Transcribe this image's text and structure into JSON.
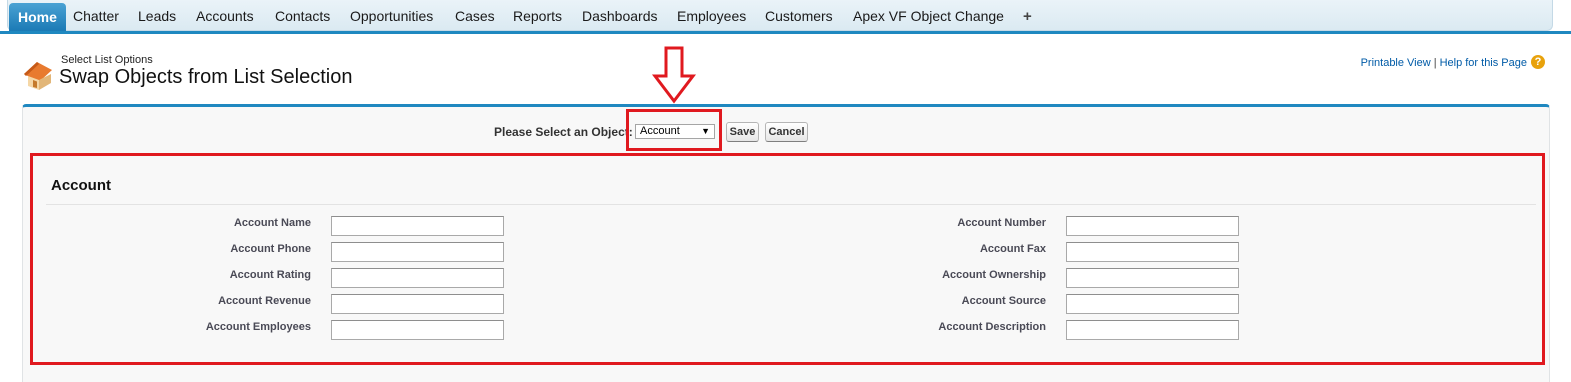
{
  "tabs": [
    {
      "label": "Home",
      "active": true
    },
    {
      "label": "Chatter"
    },
    {
      "label": "Leads"
    },
    {
      "label": "Accounts"
    },
    {
      "label": "Contacts"
    },
    {
      "label": "Opportunities"
    },
    {
      "label": "Cases"
    },
    {
      "label": "Reports"
    },
    {
      "label": "Dashboards"
    },
    {
      "label": "Employees"
    },
    {
      "label": "Customers"
    },
    {
      "label": "Apex VF Object Change"
    },
    {
      "label": "+"
    }
  ],
  "header": {
    "subtitle": "Select List Options",
    "title": "Swap Objects from List Selection",
    "printable_view": "Printable View",
    "separator": "|",
    "help": "Help for this Page",
    "help_icon": "?"
  },
  "selector": {
    "label": "Please Select an Object:",
    "selected": "Account",
    "save_label": "Save",
    "cancel_label": "Cancel"
  },
  "section": {
    "title": "Account",
    "left_fields": [
      {
        "label": "Account Name",
        "value": ""
      },
      {
        "label": "Account Phone",
        "value": ""
      },
      {
        "label": "Account Rating",
        "value": ""
      },
      {
        "label": "Account Revenue",
        "value": ""
      },
      {
        "label": "Account Employees",
        "value": ""
      }
    ],
    "right_fields": [
      {
        "label": "Account Number",
        "value": ""
      },
      {
        "label": "Account Fax",
        "value": ""
      },
      {
        "label": "Account Ownership",
        "value": ""
      },
      {
        "label": "Account Source",
        "value": ""
      },
      {
        "label": "Account Description",
        "value": ""
      }
    ]
  },
  "colors": {
    "accent": "#1f88c0",
    "highlight": "#e0191f",
    "link": "#015ba7"
  }
}
